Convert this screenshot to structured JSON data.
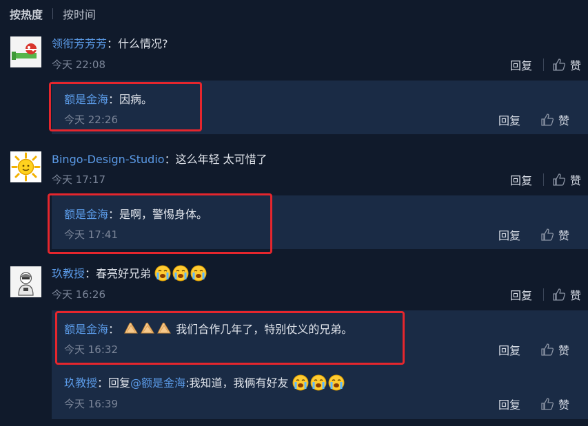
{
  "sort": {
    "hot": "按热度",
    "time": "按时间"
  },
  "actions": {
    "reply": "回复",
    "like": "赞"
  },
  "threads": [
    {
      "user": "领衔芳芳芳",
      "colon": "：",
      "text": "什么情况?",
      "time": "今天 22:08",
      "avatar": "piranha-plant-avatar",
      "replies": [
        {
          "user": "额是金海",
          "colon": "：",
          "text": "因病。",
          "time": "今天 22:26"
        }
      ]
    },
    {
      "user": "Bingo-Design-Studio",
      "colon": "：",
      "text": "这么年轻 太可惜了",
      "time": "今天 17:17",
      "avatar": "sun-avatar",
      "replies": [
        {
          "user": "额是金海",
          "colon": "：",
          "text": "是啊，警惕身体。",
          "time": "今天 17:41"
        }
      ]
    },
    {
      "user": "玖教授",
      "colon": "：",
      "text": "春亮好兄弟",
      "time": "今天 16:26",
      "avatar": "cartoon-person-avatar",
      "emoji": "crying-face",
      "replies": [
        {
          "user": "额是金海",
          "colon": "：",
          "text": "我们合作几年了，特别仗义的兄弟。",
          "time": "今天 16:32",
          "emoji": "folded-hands"
        },
        {
          "user": "玖教授",
          "colon": "：",
          "prefix": "回复",
          "mention": "@额是金海",
          "text": ":我知道，我俩有好友",
          "time": "今天 16:39",
          "emoji": "crying-face"
        }
      ]
    }
  ],
  "colors": {
    "background": "#101a2b",
    "reply_background": "#1a2b45",
    "username": "#5b9be8",
    "highlight": "#e5262d"
  }
}
